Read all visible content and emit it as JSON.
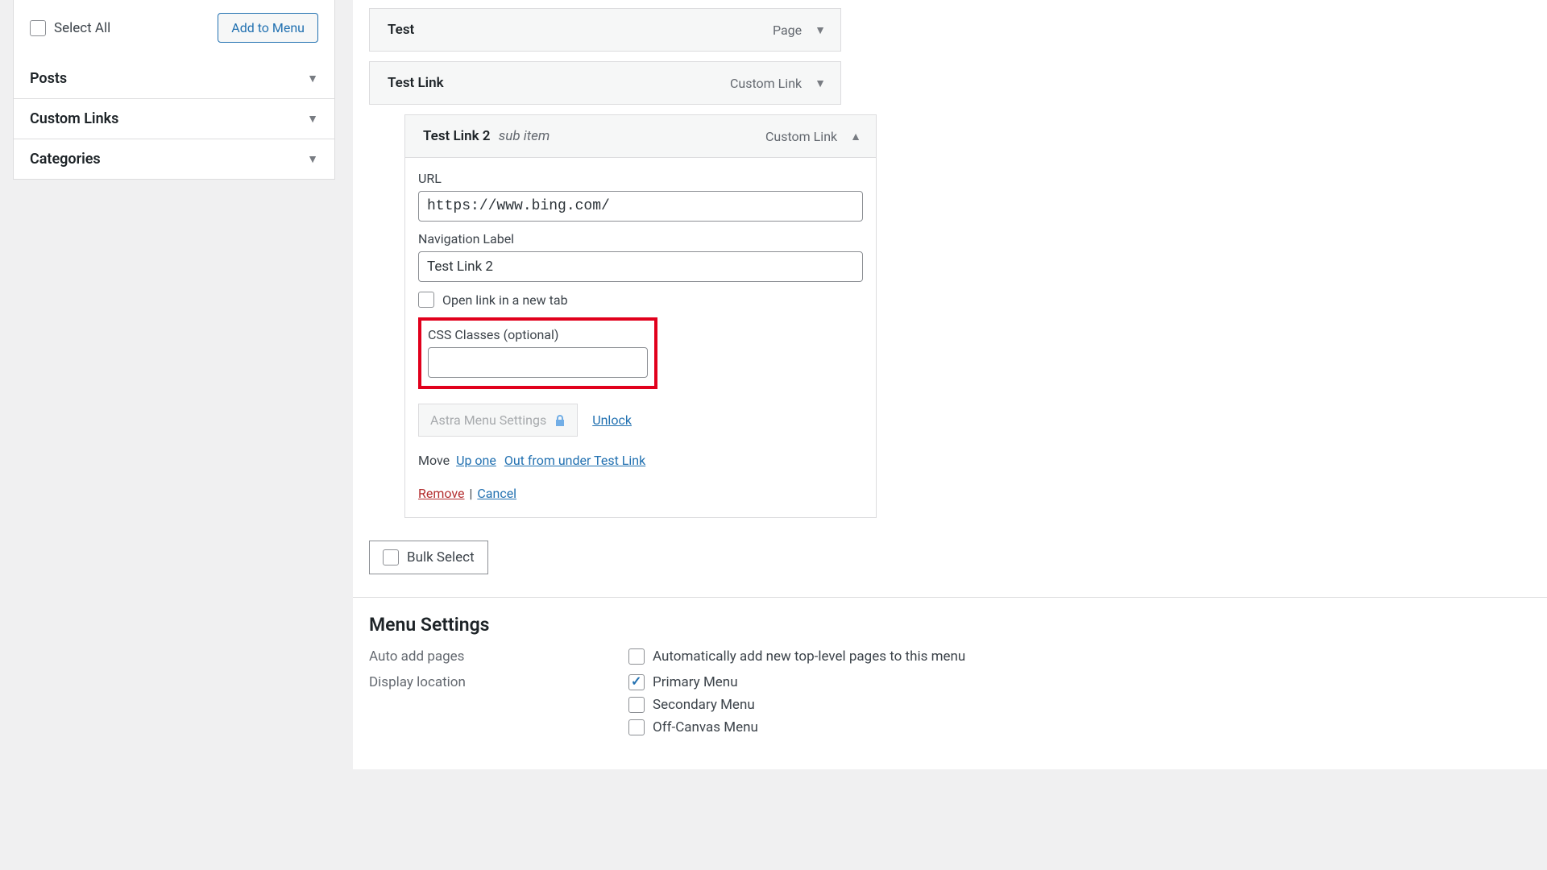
{
  "sidebar": {
    "select_all_label": "Select All",
    "add_to_menu_label": "Add to Menu",
    "panels": [
      {
        "title": "Posts"
      },
      {
        "title": "Custom Links"
      },
      {
        "title": "Categories"
      }
    ]
  },
  "menu": {
    "items": [
      {
        "title": "Test",
        "type": "Page",
        "open": false
      },
      {
        "title": "Test Link",
        "type": "Custom Link",
        "open": false
      }
    ],
    "sub_item": {
      "title": "Test Link 2",
      "sub_badge": "sub item",
      "type": "Custom Link",
      "fields": {
        "url_label": "URL",
        "url_value": "https://www.bing.com/",
        "nav_label": "Navigation Label",
        "nav_value": "Test Link 2",
        "new_tab_label": "Open link in a new tab",
        "css_label": "CSS Classes (optional)",
        "css_value": ""
      },
      "astra": {
        "badge": "Astra Menu Settings",
        "unlock": "Unlock"
      },
      "move": {
        "prefix": "Move",
        "up_one": "Up one",
        "out_from": "Out from under Test Link"
      },
      "actions": {
        "remove": "Remove",
        "cancel": "Cancel"
      }
    },
    "bulk_select_label": "Bulk Select"
  },
  "settings": {
    "title": "Menu Settings",
    "auto_add_label": "Auto add pages",
    "auto_add_opt": "Automatically add new top-level pages to this menu",
    "display_label": "Display location",
    "display_opts": [
      {
        "label": "Primary Menu",
        "checked": true
      },
      {
        "label": "Secondary Menu",
        "checked": false
      },
      {
        "label": "Off-Canvas Menu",
        "checked": false
      }
    ]
  }
}
